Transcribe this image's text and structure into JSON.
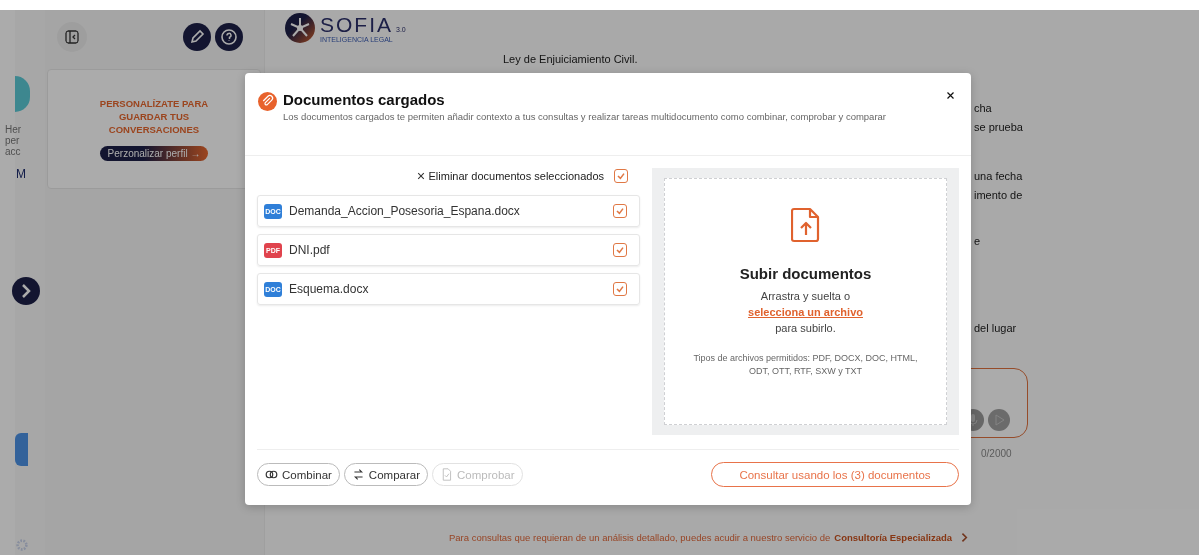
{
  "rail": {
    "fragments": [
      "Her",
      "per",
      "acc"
    ],
    "menu_fragment": "M"
  },
  "sidebar": {
    "profile_card": {
      "title": "PERSONALÍZATE PARA GUARDAR TUS CONVERSACIONES",
      "button": "Perzonalizar perfil →"
    }
  },
  "header": {
    "logo": "SOFIA",
    "version": "3.0",
    "tagline": "INTELIGENCIA LEGAL"
  },
  "chat": {
    "line": "Ley de Enjuiciamiento Civil.",
    "side_paragraphs": [
      [
        "cha",
        "se prueba"
      ],
      [
        "una fecha",
        "imento de"
      ],
      [
        "e"
      ],
      [
        "del lugar"
      ]
    ],
    "counter": "0/2000"
  },
  "footer": {
    "text": "Para consultas que requieran de un análisis detallado, puedes acudir a nuestro servicio de",
    "link": "Consultoría Especializada"
  },
  "modal": {
    "title": "Documentos cargados",
    "description": "Los documentos cargados te permiten añadir contexto a tus consultas y realizar tareas multidocumento como combinar, comprobar y comparar",
    "delete_selected": {
      "label": "Eliminar documentos seleccionados",
      "checked": true
    },
    "documents": [
      {
        "name": "Demanda_Accion_Posesoria_Espana.docx",
        "kind": "word",
        "badge": "DOC",
        "checked": true
      },
      {
        "name": "DNI.pdf",
        "kind": "pdf",
        "badge": "PDF",
        "checked": true
      },
      {
        "name": "Esquema.docx",
        "kind": "word",
        "badge": "DOC",
        "checked": true
      }
    ],
    "upload": {
      "title": "Subir documentos",
      "line_1": "Arrastra y suelta o",
      "link": "selecciona un archivo",
      "line_2": "para subirlo.",
      "types": "Tipos de archivos permitidos: PDF, DOCX, DOC, HTML, ODT, OTT, RTF, SXW y TXT"
    },
    "actions": [
      {
        "kind": "combine",
        "label": "Combinar",
        "disabled": false
      },
      {
        "kind": "compare",
        "label": "Comparar",
        "disabled": false
      },
      {
        "kind": "check",
        "label": "Comprobar",
        "disabled": true
      }
    ],
    "submit": "Consultar usando los (3) documentos"
  }
}
